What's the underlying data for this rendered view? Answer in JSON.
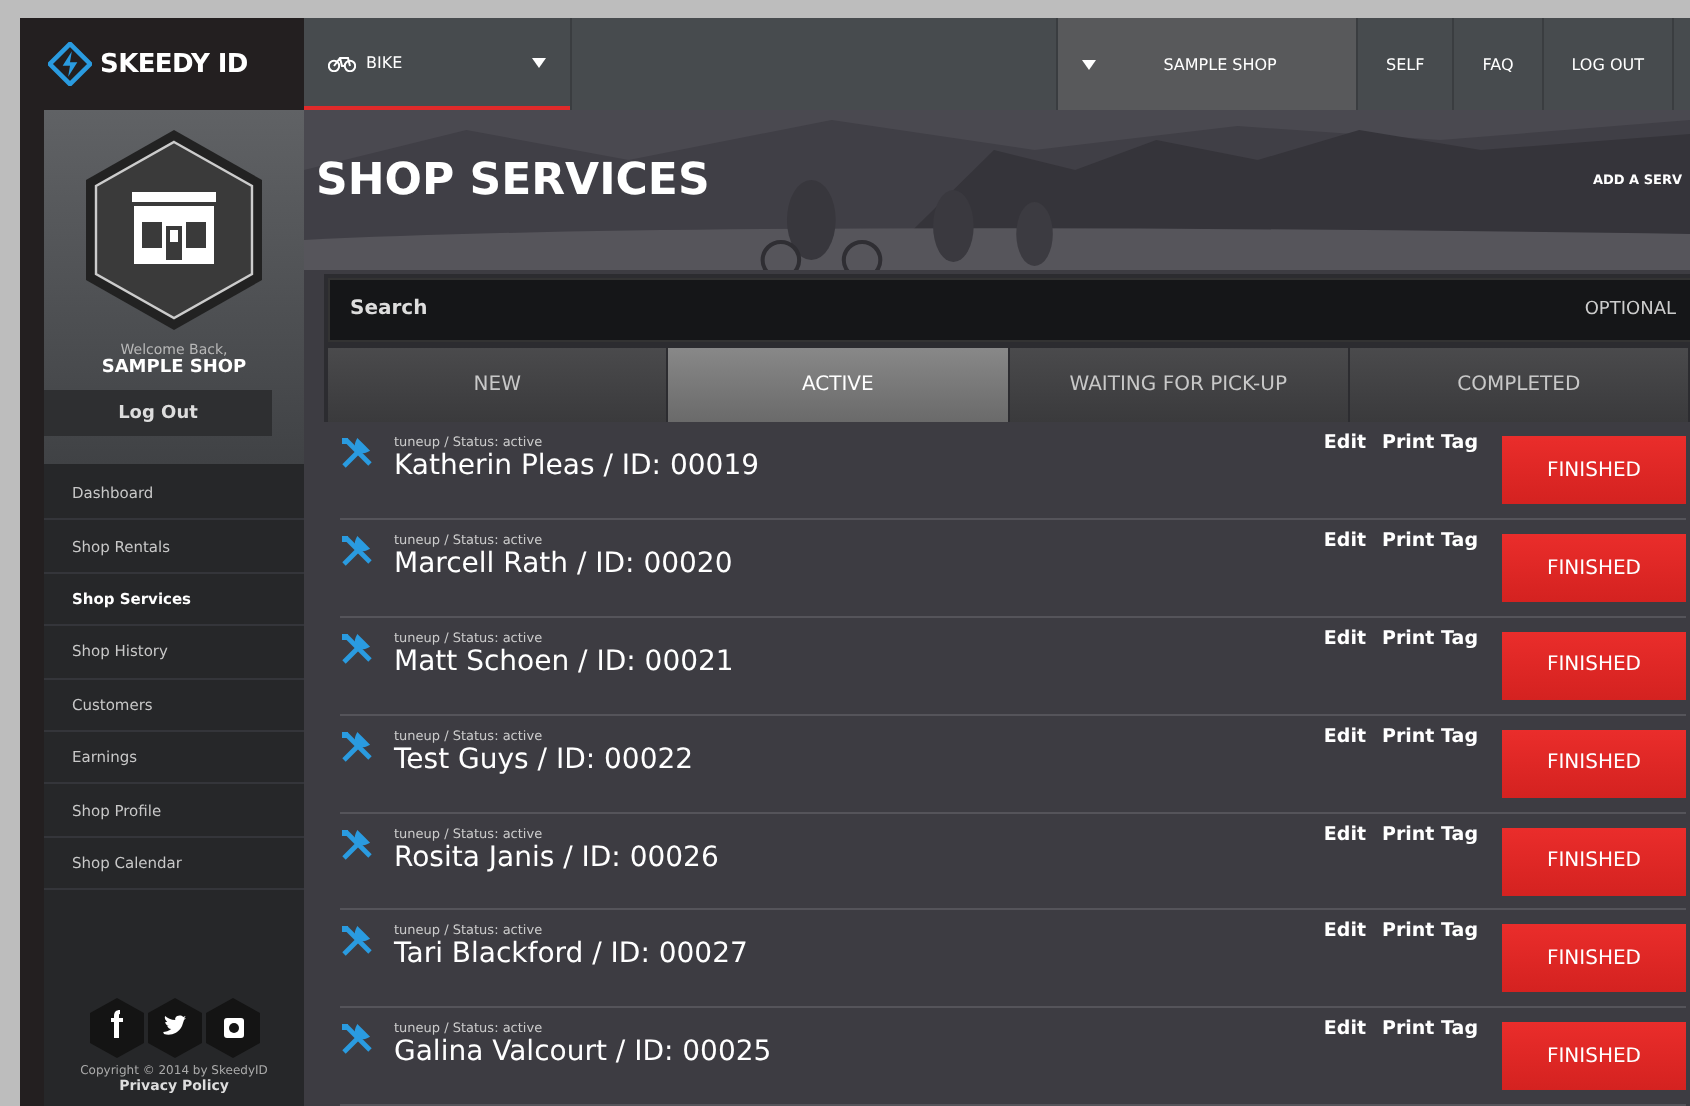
{
  "brand": {
    "name": "SKEEDY ID"
  },
  "topbar": {
    "category": {
      "label": "BIKE",
      "selected": true
    },
    "shop_menu": {
      "label": "SAMPLE SHOP"
    },
    "links": [
      "SELF",
      "FAQ",
      "LOG OUT"
    ]
  },
  "profile": {
    "welcome": "Welcome Back,",
    "shop_name": "SAMPLE SHOP",
    "logout": "Log Out"
  },
  "sidebar": {
    "items": [
      {
        "label": "Dashboard",
        "selected": false
      },
      {
        "label": "Shop Rentals",
        "selected": false
      },
      {
        "label": "Shop Services",
        "selected": true
      },
      {
        "label": "Shop History",
        "selected": false
      },
      {
        "label": "Customers",
        "selected": false
      },
      {
        "label": "Earnings",
        "selected": false
      },
      {
        "label": "Shop Profile",
        "selected": false
      },
      {
        "label": "Shop Calendar",
        "selected": false
      }
    ]
  },
  "footer": {
    "copyright": "Copyright © 2014 by SkeedyID",
    "privacy": "Privacy Policy"
  },
  "page": {
    "title": "SHOP SERVICES",
    "add_link": "ADD A SERV"
  },
  "search": {
    "label": "Search",
    "hint": "OPTIONAL"
  },
  "tabs": [
    {
      "label": "NEW",
      "selected": false
    },
    {
      "label": "ACTIVE",
      "selected": true
    },
    {
      "label": "WAITING FOR PICK-UP",
      "selected": false
    },
    {
      "label": "COMPLETED",
      "selected": false
    }
  ],
  "services": [
    {
      "meta": "tuneup / Status: active",
      "name": "Katherin Pleas / ID: 00019",
      "edit": "Edit",
      "print": "Print Tag",
      "action": "FINISHED"
    },
    {
      "meta": "tuneup / Status: active",
      "name": "Marcell Rath / ID: 00020",
      "edit": "Edit",
      "print": "Print Tag",
      "action": "FINISHED"
    },
    {
      "meta": "tuneup / Status: active",
      "name": "Matt Schoen / ID: 00021",
      "edit": "Edit",
      "print": "Print Tag",
      "action": "FINISHED"
    },
    {
      "meta": "tuneup / Status: active",
      "name": "Test Guys / ID: 00022",
      "edit": "Edit",
      "print": "Print Tag",
      "action": "FINISHED"
    },
    {
      "meta": "tuneup / Status: active",
      "name": "Rosita Janis / ID: 00026",
      "edit": "Edit",
      "print": "Print Tag",
      "action": "FINISHED"
    },
    {
      "meta": "tuneup / Status: active",
      "name": "Tari Blackford / ID: 00027",
      "edit": "Edit",
      "print": "Print Tag",
      "action": "FINISHED"
    },
    {
      "meta": "tuneup / Status: active",
      "name": "Galina Valcourt / ID: 00025",
      "edit": "Edit",
      "print": "Print Tag",
      "action": "FINISHED"
    }
  ]
}
